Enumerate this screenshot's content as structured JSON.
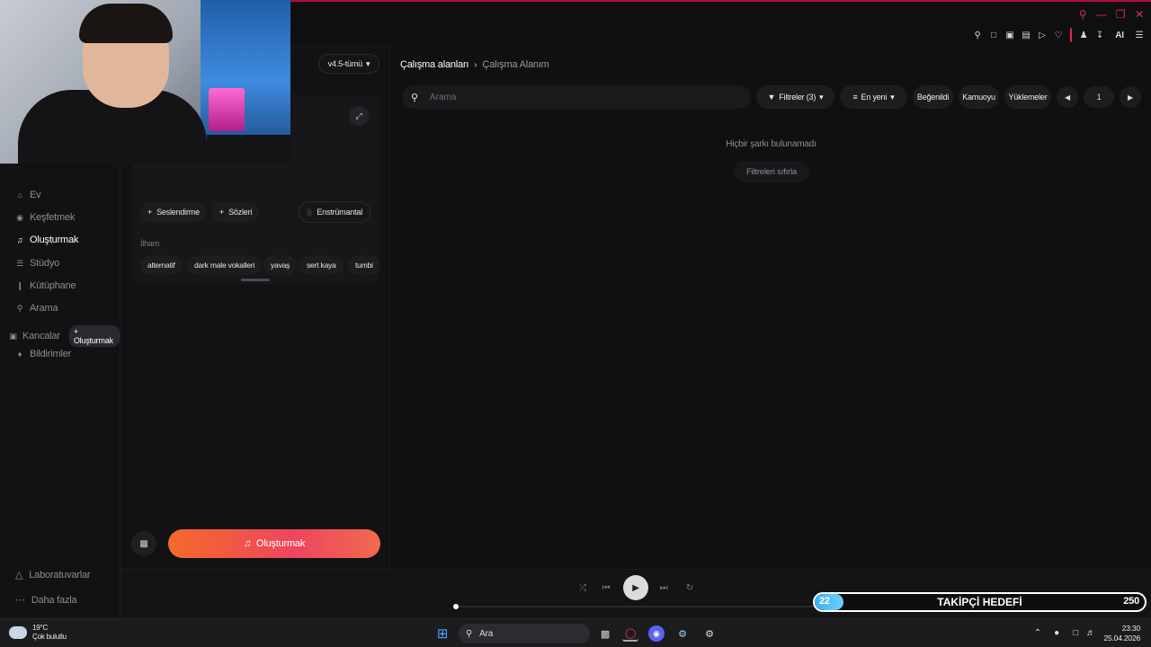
{
  "toolbar": {
    "ai_label": "AI"
  },
  "sidebar": {
    "items": [
      {
        "label": "Ev",
        "icon": "home-icon"
      },
      {
        "label": "Keşfetmek",
        "icon": "compass-icon"
      },
      {
        "label": "Oluşturmak",
        "icon": "music-note-icon",
        "active": true
      },
      {
        "label": "Stüdyo",
        "icon": "studio-icon"
      },
      {
        "label": "Kütüphane",
        "icon": "library-icon"
      },
      {
        "label": "Arama",
        "icon": "search-icon"
      },
      {
        "label": "Kancalar",
        "icon": "hook-icon",
        "badge": "+ Oluşturmak"
      },
      {
        "label": "Bildirimler",
        "icon": "bell-icon"
      }
    ],
    "bottom": [
      {
        "label": "Laboratuvarlar",
        "icon": "flask-icon"
      },
      {
        "label": "Daha fazla",
        "icon": "more-icon"
      }
    ]
  },
  "create_panel": {
    "version": "v4.5-tümü",
    "voice_label": "Seslendirme",
    "lyrics_label": "Sözleri",
    "instrumental_label": "Enstrümantal",
    "inspiration_label": "İlham",
    "chips": [
      "alternatif",
      "dark male vokalleri",
      "yavaş",
      "sert kaya",
      "tumbi"
    ],
    "create_button": "Oluşturmak"
  },
  "workspace": {
    "breadcrumb_root": "Çalışma alanları",
    "breadcrumb_current": "Çalışma Alanım",
    "search_placeholder": "Arama",
    "filters_label": "Filtreler (3)",
    "sort_label": "En yeni",
    "liked_label": "Beğenildi",
    "public_label": "Kamuoyu",
    "uploads_label": "Yüklemeler",
    "page_number": "1",
    "empty_message": "Hiçbir şarkı bulunamadı",
    "reset_filters": "Filtreleri sıfırla"
  },
  "goal_overlay": {
    "current": "22",
    "title": "TAKİPÇİ HEDEFİ",
    "target": "250",
    "progress": 0.088
  },
  "taskbar": {
    "temperature": "19°C",
    "weather": "Çok bulutlu",
    "search_label": "Ara",
    "time": "23:30",
    "date": "25.04.2026"
  },
  "colors": {
    "accent_gradient_start": "#f46a2a",
    "accent_gradient_end": "#ee4560",
    "browser_accent": "#e0284d",
    "goal_fill": "#3bb0f0"
  }
}
